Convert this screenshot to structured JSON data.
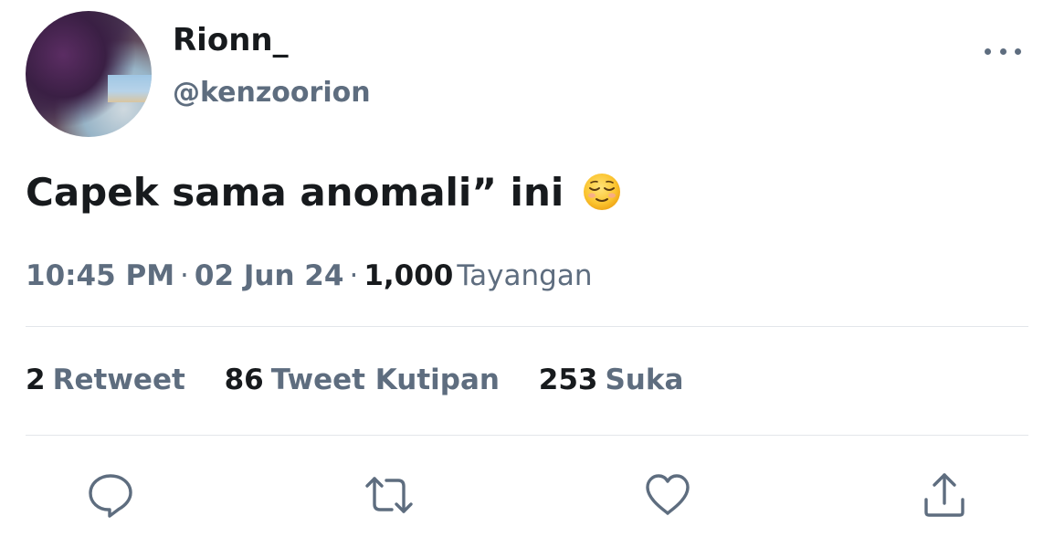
{
  "author": {
    "display_name": "Rionn_",
    "handle": "@kenzoorion"
  },
  "tweet": {
    "text": "Capek sama anomali” ini",
    "emoji": "relieved-face"
  },
  "meta": {
    "time": "10:45 PM",
    "date": "02 Jun 24",
    "views_count": "1,000",
    "views_label": "Tayangan"
  },
  "stats": [
    {
      "count": "2",
      "label": "Retweet"
    },
    {
      "count": "86",
      "label": "Tweet Kutipan"
    },
    {
      "count": "253",
      "label": "Suka"
    }
  ],
  "actions": [
    "reply-icon",
    "retweet-icon",
    "like-icon",
    "share-icon"
  ],
  "colors": {
    "text_primary": "#171a1d",
    "text_secondary": "#5e6d7f",
    "divider": "#e3e6ea"
  }
}
